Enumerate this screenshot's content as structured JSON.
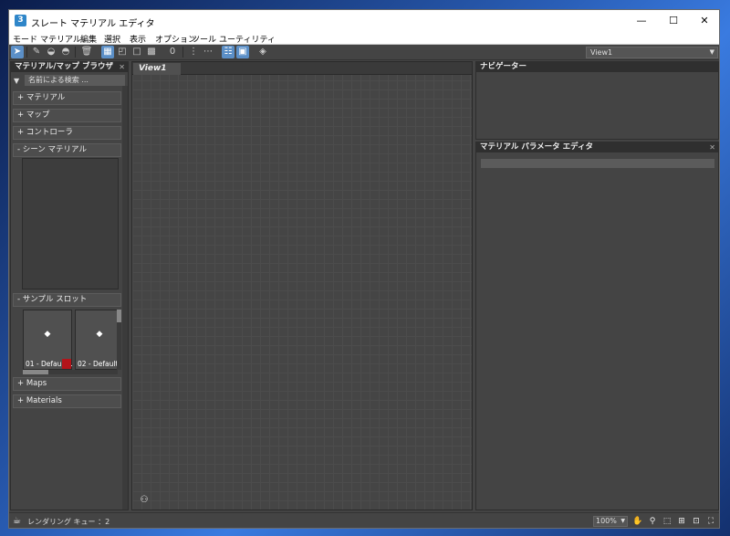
{
  "window": {
    "title": "スレート マテリアル エディタ",
    "minimize": "—",
    "maximize": "☐",
    "close": "✕"
  },
  "menu": [
    "モード",
    "マテリアル",
    "編集",
    "選択",
    "表示",
    "オプション",
    "ツール",
    "ユーティリティ"
  ],
  "toolbar": {
    "view_select": "View1"
  },
  "browser": {
    "title": "マテリアル/マップ ブラウザ",
    "search_placeholder": "名前による検索 ...",
    "sections": [
      "+ マテリアル",
      "+ マップ",
      "+ コントローラ",
      "- シーン マテリアル",
      "- サンプル スロット",
      "+ Maps",
      "+ Materials"
    ],
    "slots": [
      "01 - Default...",
      "02 - Default"
    ]
  },
  "view": {
    "tab": "View1"
  },
  "navigator": {
    "title": "ナビゲーター"
  },
  "param_editor": {
    "title": "マテリアル パラメータ エディタ"
  },
  "status": {
    "render_queue": "レンダリング キュー ：2",
    "zoom": "100%"
  },
  "icons": [
    "app-icon",
    "pick-arrow-icon",
    "eyedropper-icon",
    "delete-icon",
    "layout-icon",
    "binoculars-icon",
    "teapot-icon",
    "pan-hand-icon",
    "zoom-icon"
  ]
}
